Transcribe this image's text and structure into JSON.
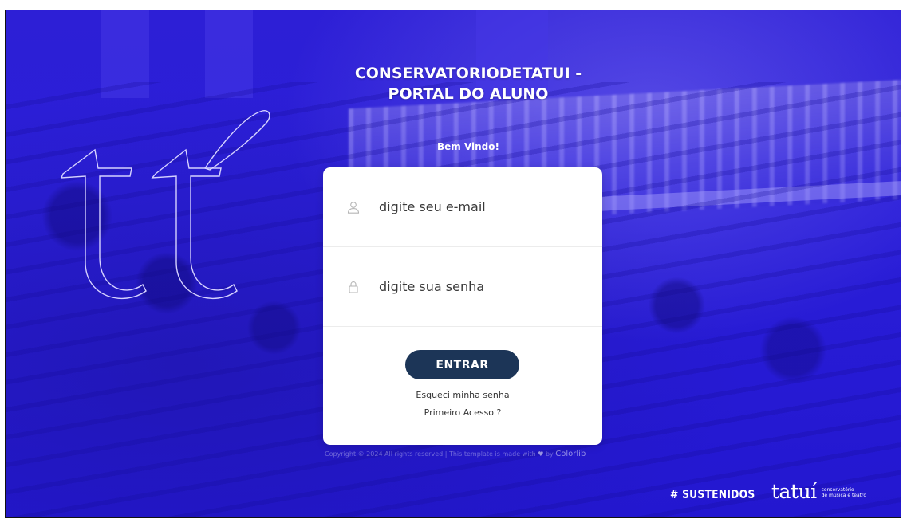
{
  "header": {
    "title_line1": "CONSERVATORIODETATUI -",
    "title_line2": "PORTAL DO ALUNO",
    "welcome": "Bem Vindo!"
  },
  "login_form": {
    "email_placeholder": "digite seu e-mail",
    "password_placeholder": "digite sua senha",
    "submit_label": "ENTRAR",
    "forgot_password_label": "Esqueci minha senha",
    "first_access_label": "Primeiro Acesso ?"
  },
  "footer": {
    "copyright_text": "Copyright © 2024 All rights reserved | This template is made with",
    "copyright_by": "by",
    "copyright_brand": "Colorlib",
    "hashtag": "# SUSTENIDOS",
    "brand_word": "tatuí",
    "brand_sub_line1": "conservatório",
    "brand_sub_line2": "de música e teatro"
  },
  "icons": {
    "email_field_icon": "user-icon",
    "password_field_icon": "lock-icon",
    "copyright_icon": "heart-icon",
    "background_logo": "tt-logo"
  },
  "colors": {
    "background_blue": "#2a1ed8",
    "button_navy": "#1c3557",
    "card_white": "#ffffff"
  }
}
